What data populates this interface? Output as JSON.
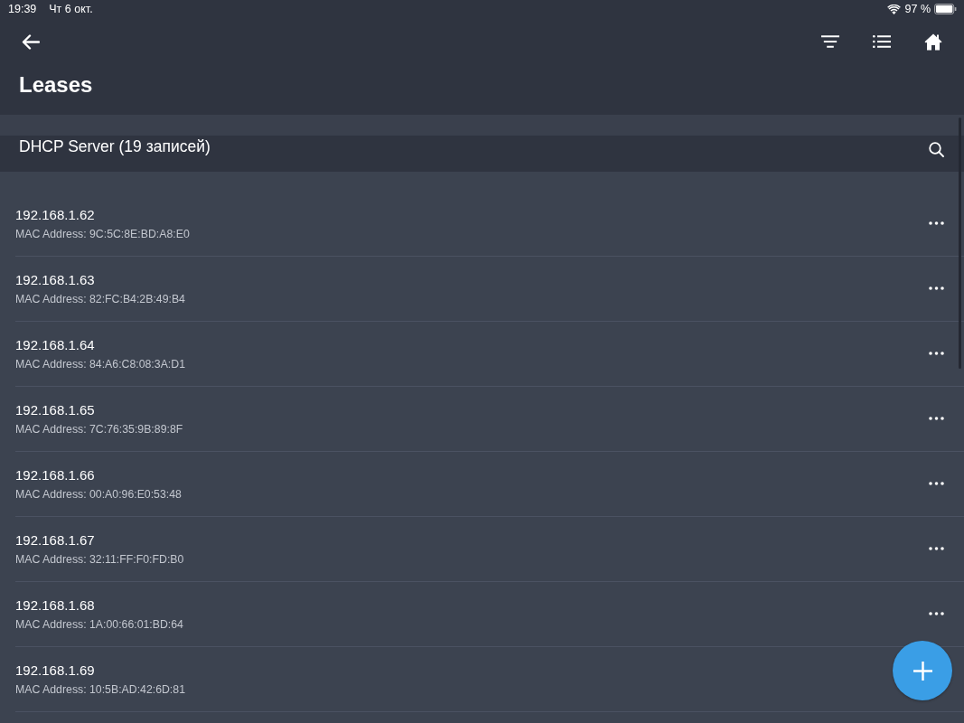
{
  "status_bar": {
    "time": "19:39",
    "date": "Чт 6 окт.",
    "battery": "97 %"
  },
  "nav": {
    "title": "Leases"
  },
  "section": {
    "title": "DHCP Server (19 записей)"
  },
  "leases": [
    {
      "ip": "192.168.1.62",
      "mac": "MAC Address: 9C:5C:8E:BD:A8:E0"
    },
    {
      "ip": "192.168.1.63",
      "mac": "MAC Address: 82:FC:B4:2B:49:B4"
    },
    {
      "ip": "192.168.1.64",
      "mac": "MAC Address: 84:A6:C8:08:3A:D1"
    },
    {
      "ip": "192.168.1.65",
      "mac": "MAC Address: 7C:76:35:9B:89:8F"
    },
    {
      "ip": "192.168.1.66",
      "mac": "MAC Address: 00:A0:96:E0:53:48"
    },
    {
      "ip": "192.168.1.67",
      "mac": "MAC Address: 32:11:FF:F0:FD:B0"
    },
    {
      "ip": "192.168.1.68",
      "mac": "MAC Address: 1A:00:66:01:BD:64"
    },
    {
      "ip": "192.168.1.69",
      "mac": "MAC Address: 10:5B:AD:42:6D:81"
    }
  ]
}
